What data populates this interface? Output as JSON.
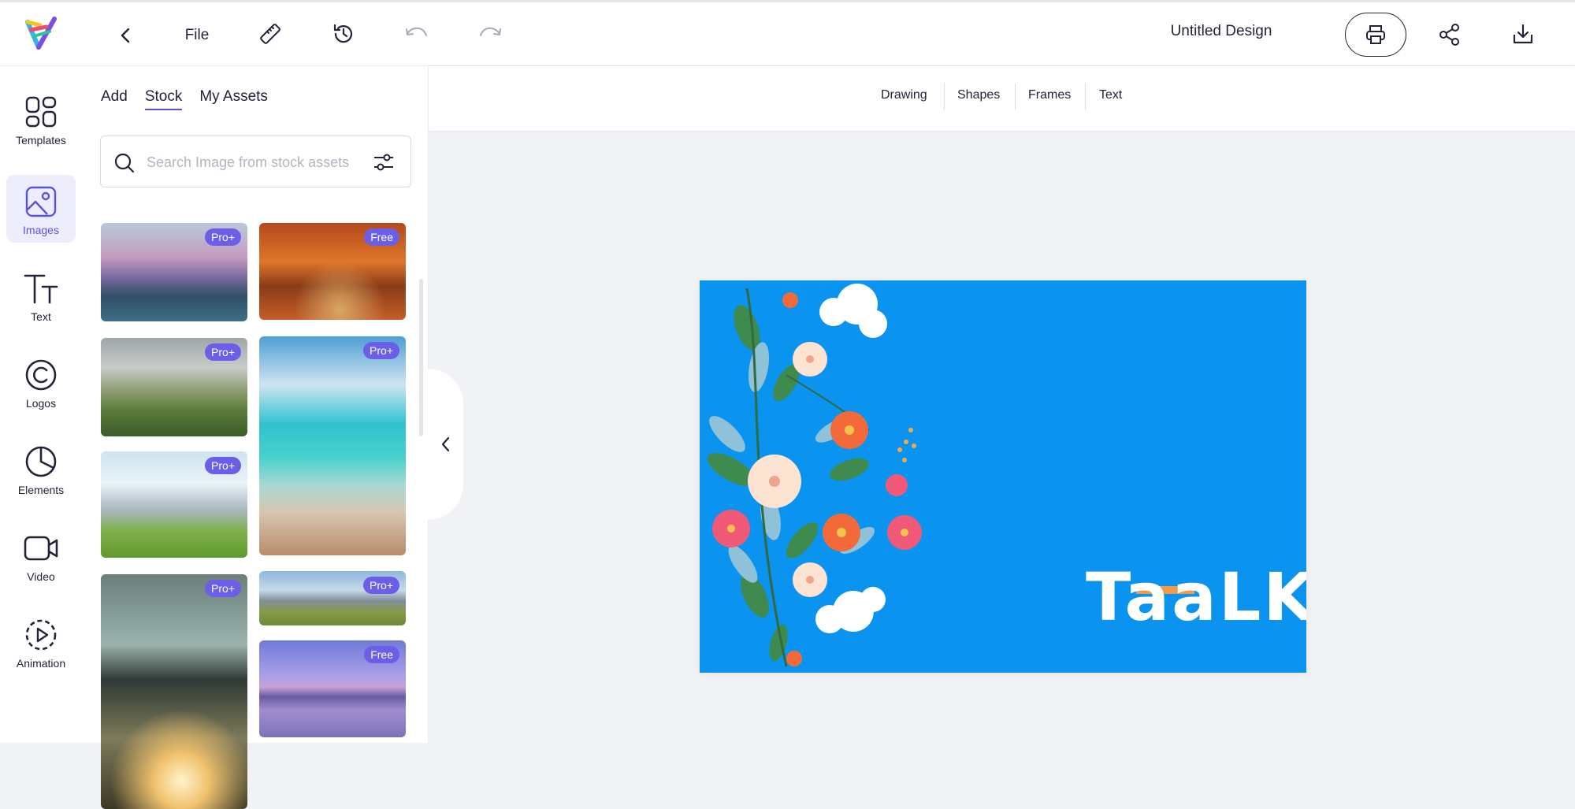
{
  "topbar": {
    "file_label": "File",
    "doc_title": "Untitled Design",
    "icons": [
      "logo",
      "chevron-left-icon",
      "ruler-icon",
      "history-icon",
      "undo-icon",
      "redo-icon",
      "printer-icon",
      "share-icon",
      "download-icon"
    ]
  },
  "nav": {
    "items": [
      {
        "label": "Templates",
        "icon": "grid-icon"
      },
      {
        "label": "Images",
        "icon": "image-icon"
      },
      {
        "label": "Text",
        "icon": "text-icon"
      },
      {
        "label": "Logos",
        "icon": "copyright-icon"
      },
      {
        "label": "Elements",
        "icon": "pie-icon"
      },
      {
        "label": "Video",
        "icon": "video-icon"
      },
      {
        "label": "Animation",
        "icon": "play-circle-icon"
      }
    ],
    "active_index": 1
  },
  "panel": {
    "tabs": [
      "Add",
      "Stock",
      "My Assets"
    ],
    "active_tab": 1,
    "search_placeholder": "Search Image from stock assets",
    "images": [
      {
        "badge": "Pro+",
        "subject": "mountain lake"
      },
      {
        "badge": "Free",
        "subject": "autumn forest path"
      },
      {
        "badge": "Pro+",
        "subject": "green valley"
      },
      {
        "badge": "Pro+",
        "subject": "tropical beach"
      },
      {
        "badge": "Pro+",
        "subject": "city skyline park"
      },
      {
        "badge": "Pro+",
        "subject": "palm trees sunset"
      },
      {
        "badge": "Pro+",
        "subject": "mountain meadow"
      },
      {
        "badge": "Free",
        "subject": "purple lake tree"
      }
    ]
  },
  "toolbar": {
    "tools": [
      "Drawing",
      "Shapes",
      "Frames",
      "Text"
    ]
  },
  "canvas": {
    "background": "#0a94ef",
    "brand_text": "TaaLK",
    "accent": "#f39a4a"
  },
  "colors": {
    "primary": "#5b52e0",
    "badge": "#6a5fe6"
  }
}
